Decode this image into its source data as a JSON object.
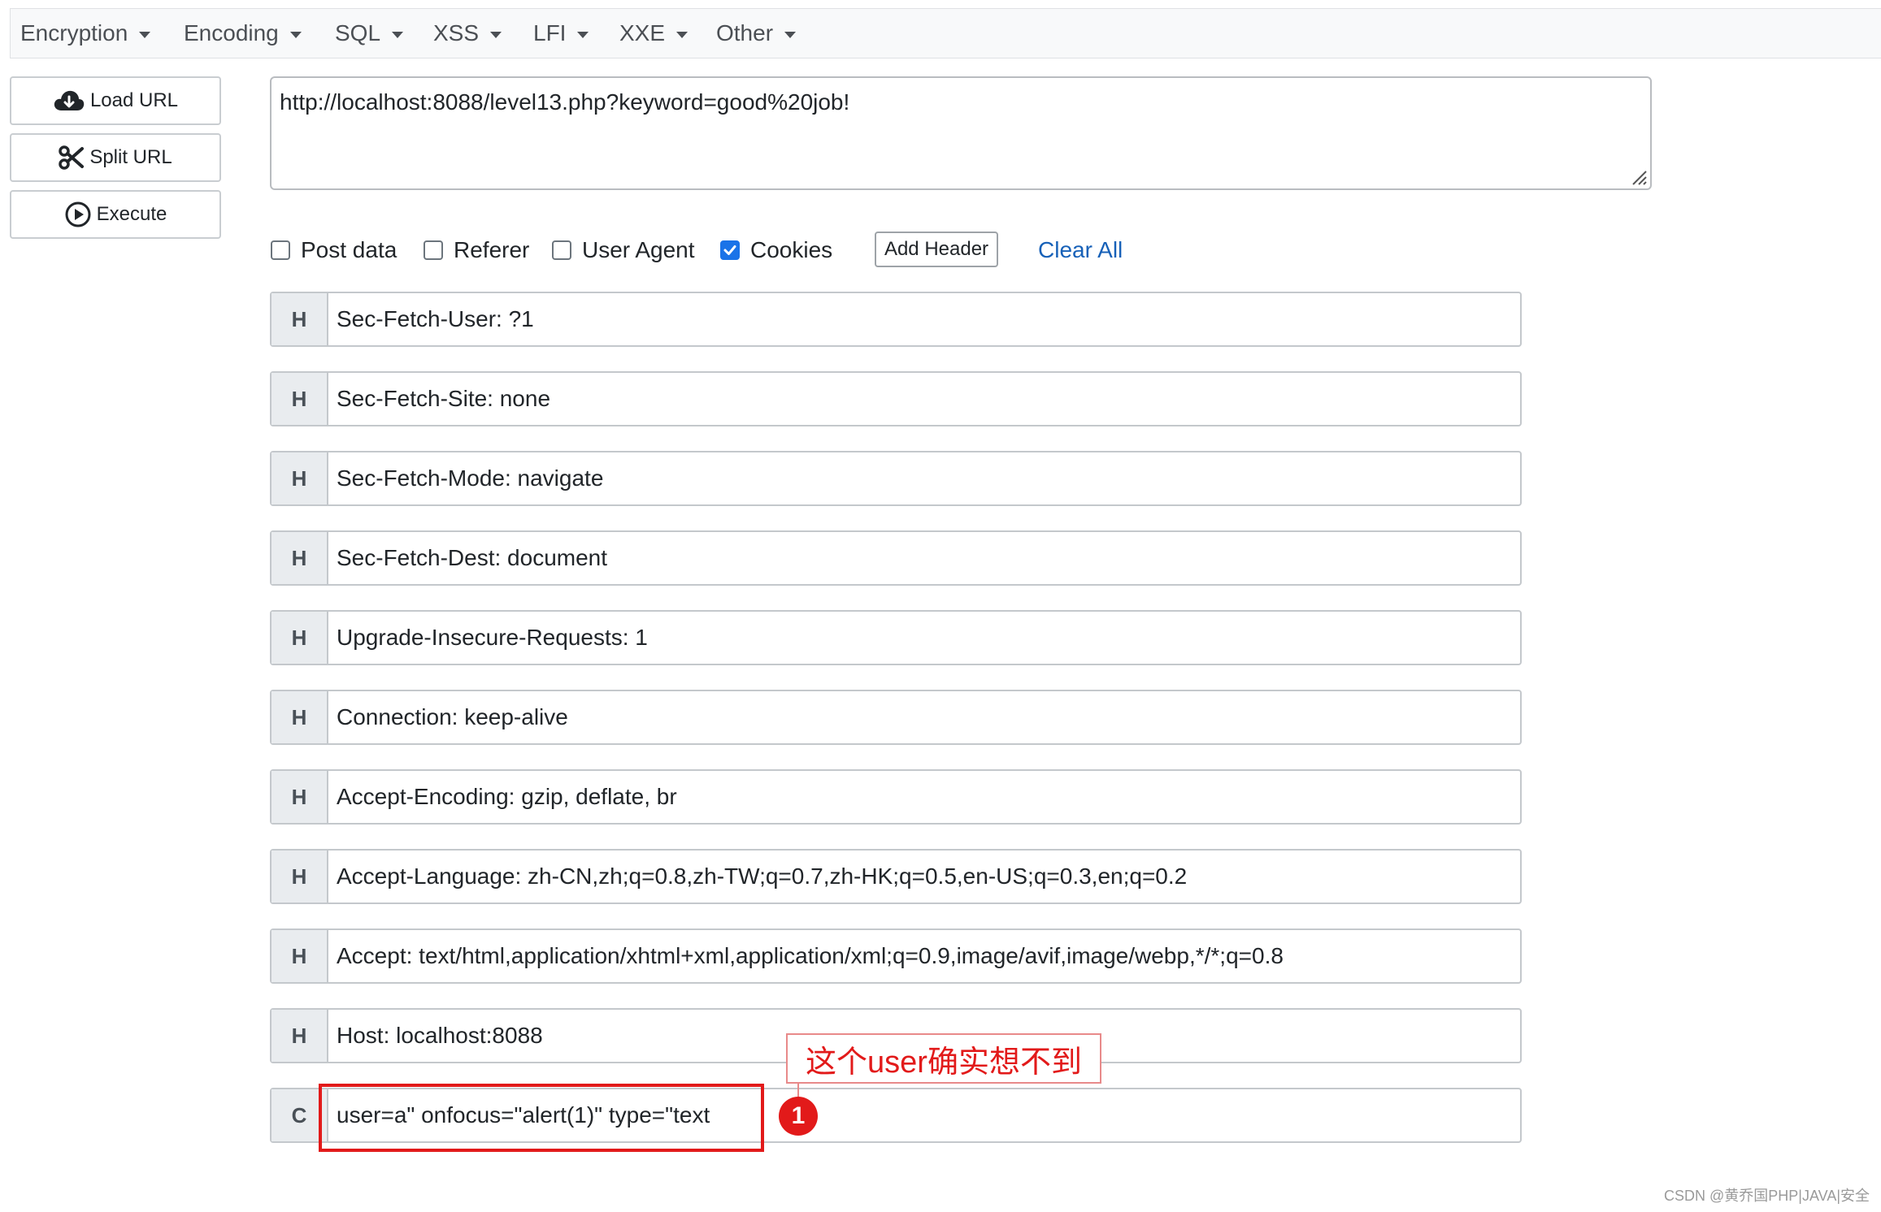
{
  "menu": {
    "items": [
      {
        "label": "Encryption"
      },
      {
        "label": "Encoding"
      },
      {
        "label": "SQL"
      },
      {
        "label": "XSS"
      },
      {
        "label": "LFI"
      },
      {
        "label": "XXE"
      },
      {
        "label": "Other"
      }
    ]
  },
  "sidebar": {
    "load_url": "Load URL",
    "split_url": "Split URL",
    "execute": "Execute"
  },
  "url": {
    "value": "http://localhost:8088/level13.php?keyword=good%20job!"
  },
  "options": {
    "post_data": {
      "label": "Post data",
      "checked": false
    },
    "referer": {
      "label": "Referer",
      "checked": false
    },
    "user_agent": {
      "label": "User Agent",
      "checked": false
    },
    "cookies": {
      "label": "Cookies",
      "checked": true
    },
    "add_header": "Add Header",
    "clear_all": "Clear All"
  },
  "headers": [
    {
      "type": "H",
      "value": "Sec-Fetch-User: ?1"
    },
    {
      "type": "H",
      "value": "Sec-Fetch-Site: none"
    },
    {
      "type": "H",
      "value": "Sec-Fetch-Mode: navigate"
    },
    {
      "type": "H",
      "value": "Sec-Fetch-Dest: document"
    },
    {
      "type": "H",
      "value": "Upgrade-Insecure-Requests: 1"
    },
    {
      "type": "H",
      "value": "Connection: keep-alive"
    },
    {
      "type": "H",
      "value": "Accept-Encoding: gzip, deflate, br"
    },
    {
      "type": "H",
      "value": "Accept-Language: zh-CN,zh;q=0.8,zh-TW;q=0.7,zh-HK;q=0.5,en-US;q=0.3,en;q=0.2"
    },
    {
      "type": "H",
      "value": "Accept: text/html,application/xhtml+xml,application/xml;q=0.9,image/avif,image/webp,*/*;q=0.8"
    },
    {
      "type": "H",
      "value": "Host: localhost:8088"
    },
    {
      "type": "C",
      "value": "user=a\" onfocus=\"alert(1)\" type=\"text"
    }
  ],
  "annotation": {
    "label": "这个user确实想不到",
    "marker": "1"
  },
  "watermark": "CSDN @黄乔国PHP|JAVA|安全",
  "colors": {
    "accent": "#1a73e8",
    "link": "#1761b8",
    "annotation": "#e21a1a"
  }
}
